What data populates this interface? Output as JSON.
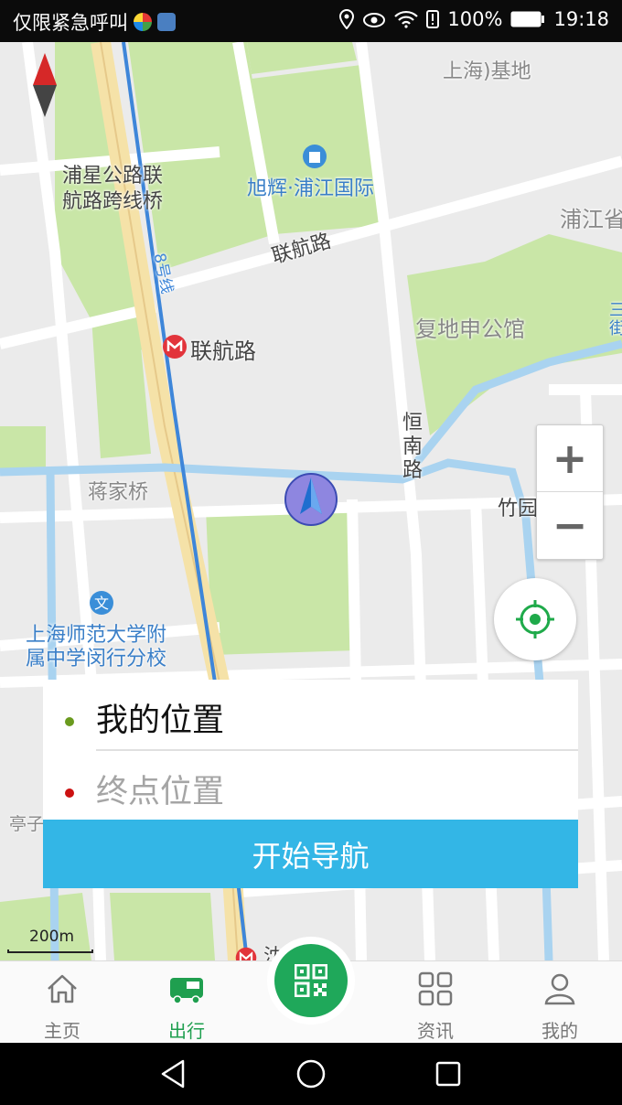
{
  "status_bar": {
    "carrier_text": "仅限紧急呼叫",
    "battery_percent": "100%",
    "time": "19:18",
    "icons": [
      "location-icon",
      "eye-icon",
      "wifi-icon",
      "battery-info-icon",
      "battery-icon"
    ]
  },
  "map": {
    "labels": {
      "pujiang_base": "上海)基地",
      "puxing_bridge_1": "浦星公路联",
      "puxing_bridge_2": "航路跨线桥",
      "xuhui": "旭辉·浦江国际",
      "pujiang_right": "浦江省",
      "lianhang_road": "联航路",
      "line8": "8号线",
      "station_lianhang": "联航路",
      "fudi": "复地申公馆",
      "hengnan": "恒南路",
      "jiangjia_bridge": "蒋家桥",
      "zhuyuan_road": "竹园路",
      "school_1": "上海师范大学附",
      "school_2": "属中学闵行分校",
      "tingzi": "亭子",
      "bottom_station": "沈 路",
      "far_right": "三街"
    },
    "zoom_in": "+",
    "zoom_out": "−",
    "scale_label": "200m"
  },
  "route_panel": {
    "start": "我的位置",
    "end_placeholder": "终点位置",
    "navigate_button": "开始导航",
    "start_dot_color": "#6a9a1e",
    "end_dot_color": "#cc1111"
  },
  "tabs": [
    {
      "label": "主页",
      "icon": "home-icon",
      "active": false
    },
    {
      "label": "出行",
      "icon": "bus-icon",
      "active": true
    },
    {
      "label": "资讯",
      "icon": "grid-icon",
      "active": false
    },
    {
      "label": "我的",
      "icon": "user-icon",
      "active": false
    }
  ],
  "colors": {
    "accent_green": "#1f9f4f",
    "navigate_blue": "#33b6e6"
  }
}
